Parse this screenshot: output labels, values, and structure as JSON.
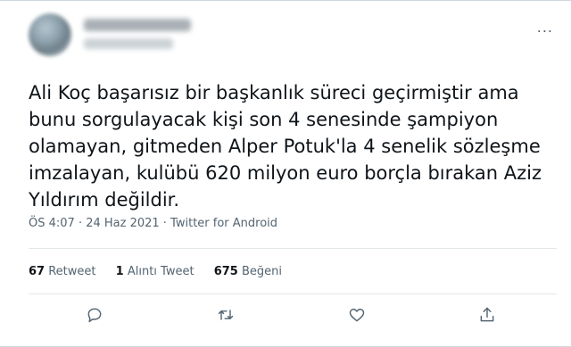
{
  "tweet": {
    "more_label": "...",
    "text": "Ali Koç başarısız bir başkanlık süreci geçirmiştir ama bunu sorgulayacak kişi son 4 senesinde şampiyon olamayan, gitmeden Alper Potuk'la 4 senelik sözleşme imzalayan, kulübü 620 milyon euro borçla bırakan Aziz Yıldırım değildir.",
    "meta": "ÖS 4:07 · 24 Haz 2021 · Twitter for Android",
    "stats": {
      "retweets_count": "67",
      "retweets_label": "Retweet",
      "quotes_count": "1",
      "quotes_label": "Alıntı Tweet",
      "likes_count": "675",
      "likes_label": "Beğeni"
    },
    "actions": [
      "reply-icon",
      "retweet-icon",
      "like-icon",
      "share-icon"
    ]
  }
}
